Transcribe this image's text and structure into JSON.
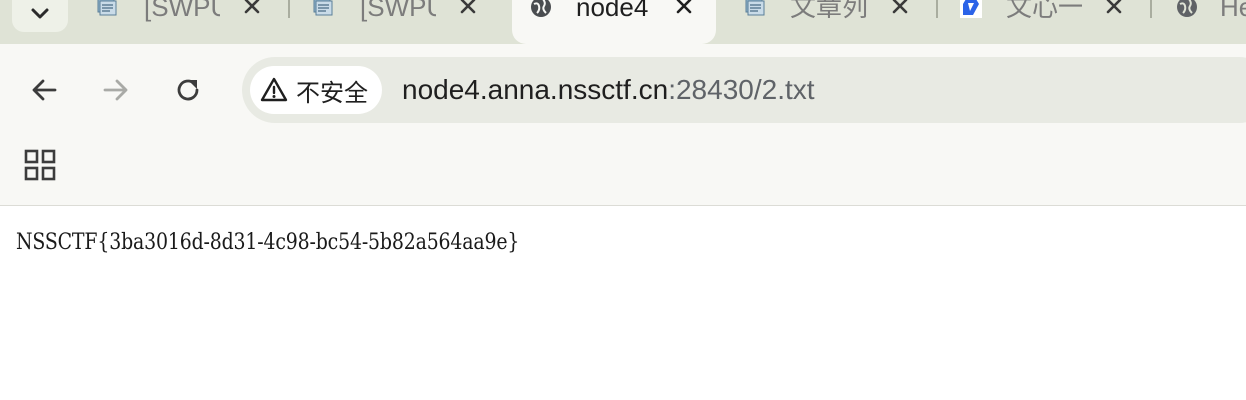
{
  "tabs": [
    {
      "title": "[SWPU",
      "favicon": "document-stack-icon",
      "active": false
    },
    {
      "title": "[SWPU",
      "favicon": "document-stack-icon",
      "active": false
    },
    {
      "title": "node4",
      "favicon": "globe-icon",
      "active": true
    },
    {
      "title": "文章列",
      "favicon": "document-stack-icon",
      "active": false
    },
    {
      "title": "文心一",
      "favicon": "ernie-logo-icon",
      "active": false
    },
    {
      "title": "He",
      "favicon": "globe-icon",
      "active": false
    }
  ],
  "toolbar": {
    "back_icon": "arrow-left-icon",
    "forward_icon": "arrow-right-icon",
    "reload_icon": "reload-icon",
    "apps_icon": "apps-grid-icon"
  },
  "omnibox": {
    "security_label": "不安全",
    "security_icon": "warning-triangle-icon",
    "url_host": "node4.anna.nssctf.cn",
    "url_path": ":28430/2.txt"
  },
  "page": {
    "text": "NSSCTF{3ba3016d-8d31-4c98-bc54-5b82a564aa9e}"
  },
  "colors": {
    "tabstrip_bg": "#dfe3d6",
    "toolbar_bg": "#f8f8f5",
    "omnibox_bg": "#e8eae3",
    "page_bg": "#ffffff"
  }
}
